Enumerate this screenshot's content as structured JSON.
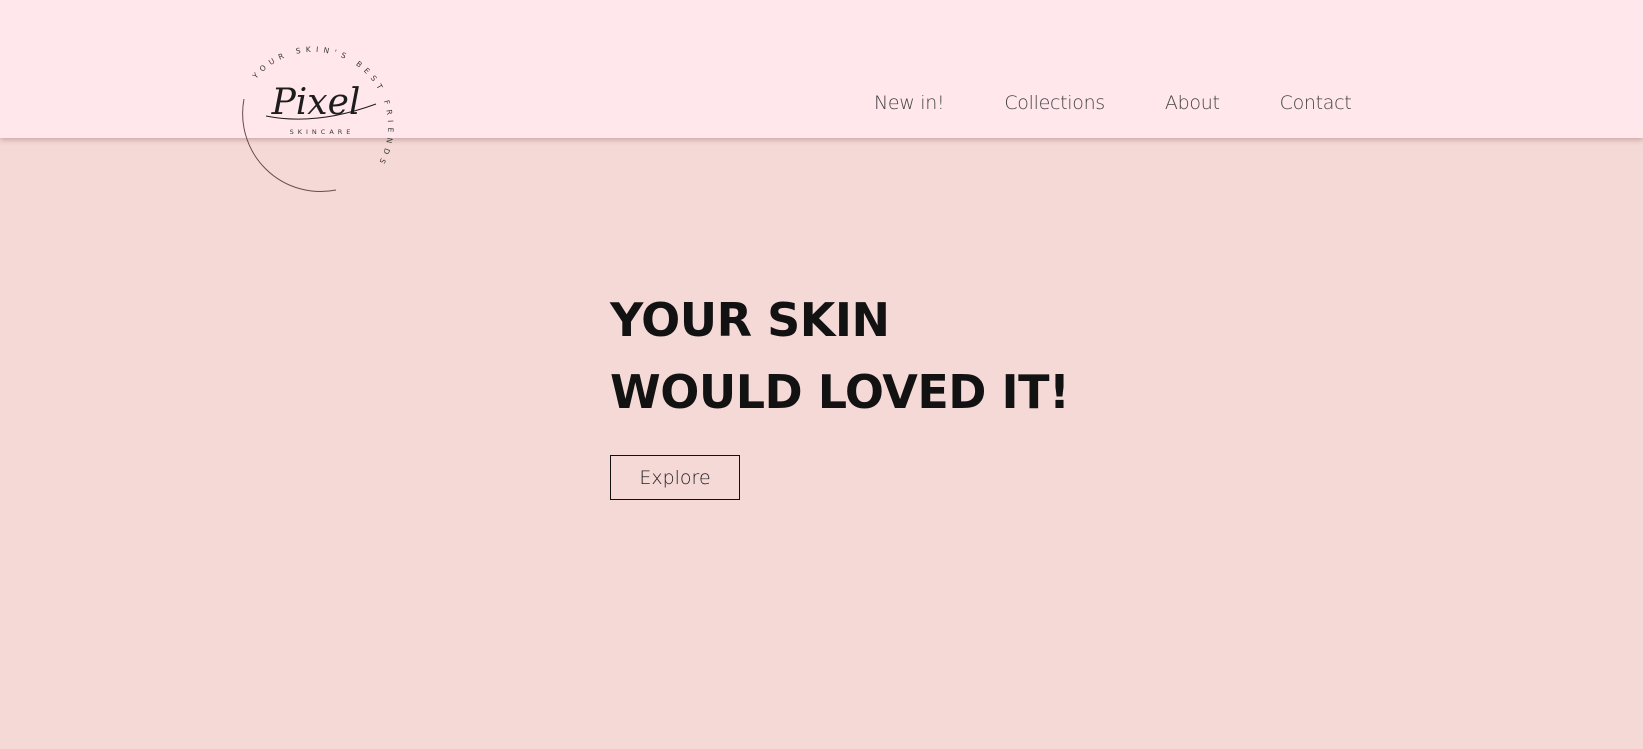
{
  "colors": {
    "header_bg": "#ffe7ec",
    "page_bg": "#f5d9d6",
    "text_dark": "#121212",
    "nav_text": "#444444"
  },
  "logo": {
    "ring_text": "YOUR SKIN'S BEST FRIENDS",
    "wordmark": "Pixel",
    "subtitle": "SKINCARE"
  },
  "nav": {
    "items": [
      {
        "label": "New in!"
      },
      {
        "label": "Collections"
      },
      {
        "label": "About"
      },
      {
        "label": "Contact"
      }
    ]
  },
  "hero": {
    "title_line1": "YOUR SKIN",
    "title_line2": "WOULD LOVED IT!",
    "cta_label": "Explore"
  }
}
